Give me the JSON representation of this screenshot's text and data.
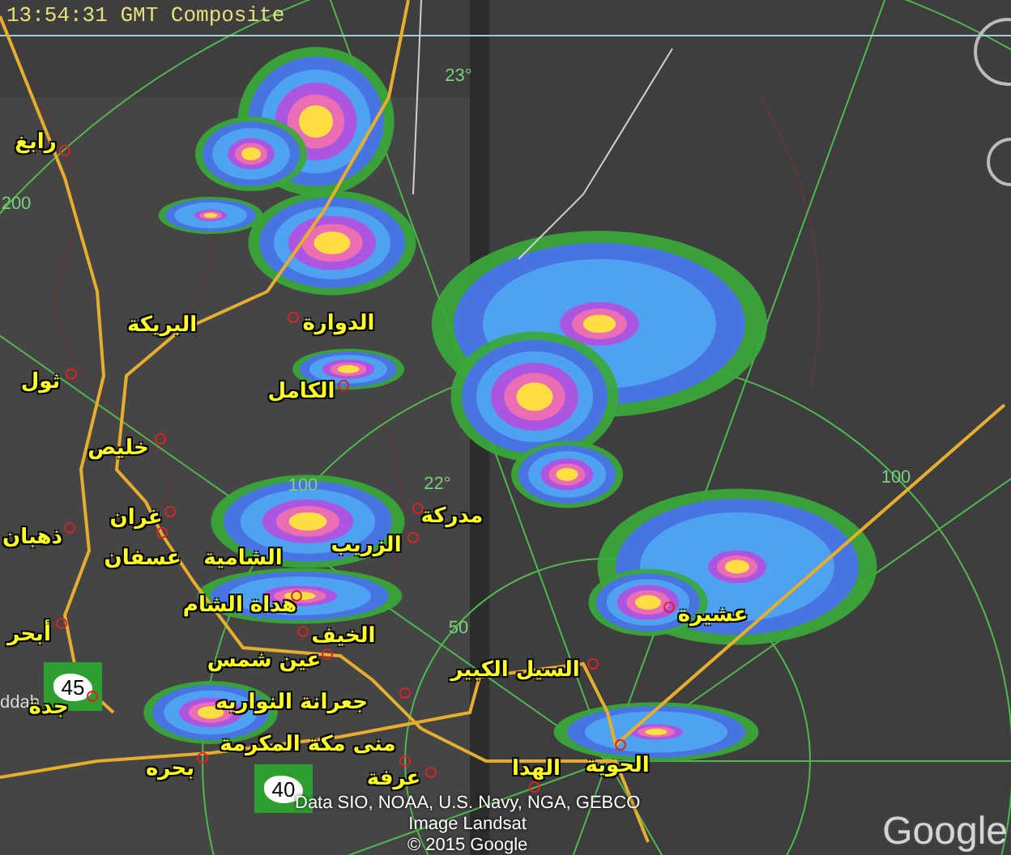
{
  "header": {
    "text": "13:54:31 GMT Composite"
  },
  "places": [
    {
      "name": "رابغ"
    },
    {
      "name": "البريكة"
    },
    {
      "name": "ثول"
    },
    {
      "name": "الدوارة"
    },
    {
      "name": "الكامل"
    },
    {
      "name": "خليص"
    },
    {
      "name": "غران"
    },
    {
      "name": "ذهبان"
    },
    {
      "name": "عسفان"
    },
    {
      "name": "الشامية"
    },
    {
      "name": "الزريب"
    },
    {
      "name": "مدركة"
    },
    {
      "name": "هداة الشام"
    },
    {
      "name": "أبحر"
    },
    {
      "name": "الخيف"
    },
    {
      "name": "عين شمس"
    },
    {
      "name": "جعرانة النواريه"
    },
    {
      "name": "جدة"
    },
    {
      "name": "منى مكة المكرمة"
    },
    {
      "name": "عرفة"
    },
    {
      "name": "بحره"
    },
    {
      "name": "السيل الكبير"
    },
    {
      "name": "عشيرة"
    },
    {
      "name": "الحوية"
    },
    {
      "name": "الهدا"
    }
  ],
  "city_label": "ddah",
  "ring_labels": [
    "200",
    "100",
    "100",
    "50",
    "23°",
    "22°"
  ],
  "road_shields": [
    "45",
    "40"
  ],
  "attribution": [
    "Data SIO, NOAA, U.S. Navy, NGA, GEBCO",
    "Image Landsat",
    "© 2015 Google"
  ],
  "logo": "Google"
}
